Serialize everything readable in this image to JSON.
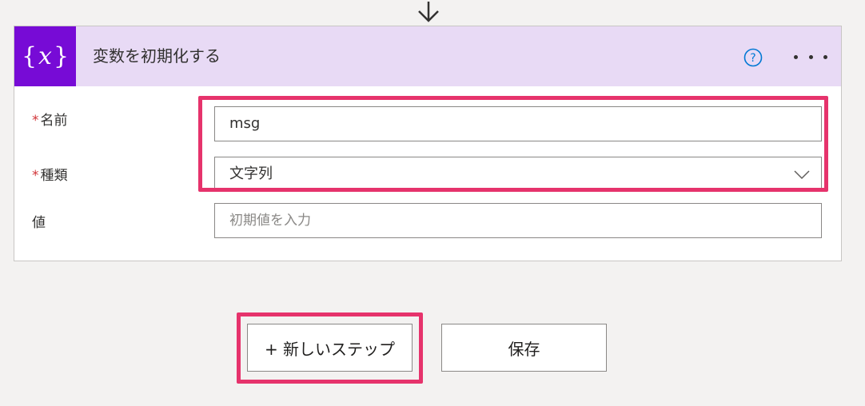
{
  "card": {
    "icon_text": "{x}",
    "title": "変数を初期化する",
    "accent_color": "#770bd6",
    "header_color": "#e8daf5"
  },
  "fields": {
    "name": {
      "label": "名前",
      "required_mark": "*",
      "value": "msg"
    },
    "type": {
      "label": "種類",
      "required_mark": "*",
      "value": "文字列"
    },
    "value": {
      "label": "値",
      "placeholder": "初期値を入力"
    }
  },
  "actions": {
    "new_step_label": "+ 新しいステップ",
    "save_label": "保存"
  },
  "highlight_color": "#e6336c"
}
